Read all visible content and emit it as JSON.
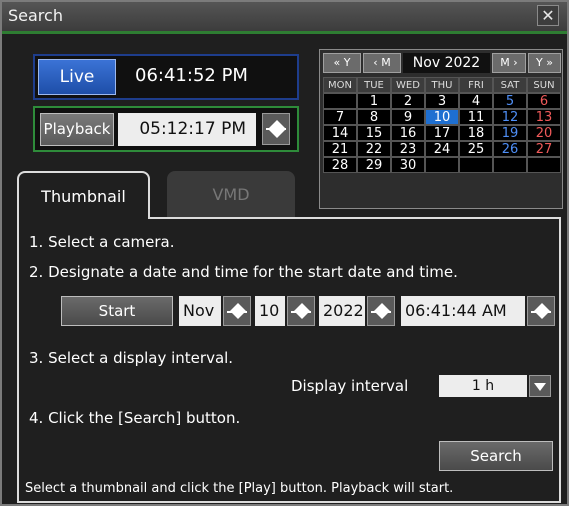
{
  "window": {
    "title": "Search",
    "close_glyph": "✕"
  },
  "live": {
    "button_label": "Live",
    "time": "06:41:52 PM"
  },
  "playback": {
    "label": "Playback",
    "time": "05:12:17 PM"
  },
  "calendar": {
    "nav": {
      "prev_year": "« Y",
      "prev_month": "‹ M",
      "next_month": "M ›",
      "next_year": "Y »"
    },
    "month_label": "Nov 2022",
    "weekdays": [
      "MON",
      "TUE",
      "WED",
      "THU",
      "FRI",
      "SAT",
      "SUN"
    ],
    "weeks": [
      [
        "",
        "1",
        "2",
        "3",
        "4",
        "5",
        "6"
      ],
      [
        "7",
        "8",
        "9",
        "10",
        "11",
        "12",
        "13"
      ],
      [
        "14",
        "15",
        "16",
        "17",
        "18",
        "19",
        "20"
      ],
      [
        "21",
        "22",
        "23",
        "24",
        "25",
        "26",
        "27"
      ],
      [
        "28",
        "29",
        "30",
        "",
        "",
        "",
        ""
      ]
    ],
    "selected_day": "10",
    "colors": {
      "saturday": "#4f8ff7",
      "sunday": "#f05a5a",
      "selected": "#1e6fd1"
    }
  },
  "tabs": [
    {
      "label": "Thumbnail",
      "active": true
    },
    {
      "label": "VMD",
      "active": false
    }
  ],
  "panel": {
    "step1": "1. Select a camera.",
    "step2": "2. Designate a date and time for the start date and time.",
    "start_button": "Start",
    "month": "Nov",
    "day": "10",
    "year": "2022",
    "start_time": "06:41:44 AM",
    "step3": "3. Select a display interval.",
    "display_interval_label": "Display interval",
    "display_interval_value": "1 h",
    "step4": "4. Click the [Search] button.",
    "search_button": "Search",
    "footer_hint": "Select a thumbnail and click the [Play] button. Playback will start."
  }
}
